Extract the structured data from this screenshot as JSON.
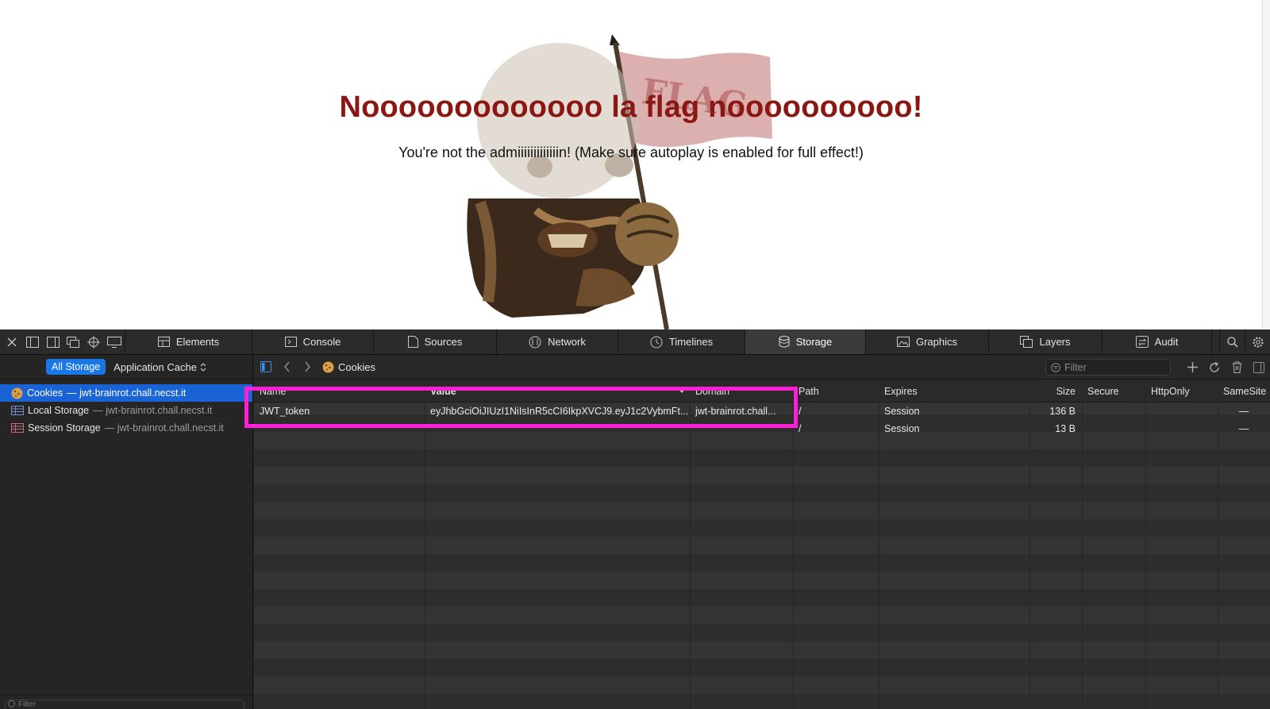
{
  "page": {
    "headline": "Nooooooooooooo la flag noooooooooo!",
    "subline": "You're not the admiiiiiiiiiiiiin! (Make sure autoplay is enabled for full effect!)",
    "flag_text": "FLAG"
  },
  "devtools": {
    "tabs": [
      {
        "label": "Elements",
        "icon": "elements-icon"
      },
      {
        "label": "Console",
        "icon": "console-icon"
      },
      {
        "label": "Sources",
        "icon": "sources-icon"
      },
      {
        "label": "Network",
        "icon": "network-icon"
      },
      {
        "label": "Timelines",
        "icon": "timelines-icon"
      },
      {
        "label": "Storage",
        "icon": "storage-icon",
        "selected": true
      },
      {
        "label": "Graphics",
        "icon": "graphics-icon"
      },
      {
        "label": "Layers",
        "icon": "layers-icon"
      },
      {
        "label": "Audit",
        "icon": "audit-icon"
      }
    ],
    "sidebar": {
      "all_storage": "All Storage",
      "scope_select": "Application Cache",
      "items": [
        {
          "label": "Cookies",
          "host": "— jwt-brainrot.chall.necst.it",
          "icon": "cookie-icon",
          "selected": true
        },
        {
          "label": "Local Storage",
          "host": "— jwt-brainrot.chall.necst.it",
          "icon": "table-icon"
        },
        {
          "label": "Session Storage",
          "host": "— jwt-brainrot.chall.necst.it",
          "icon": "table-icon"
        }
      ],
      "bottom_filter_placeholder": "Filter"
    },
    "content": {
      "breadcrumb": "Cookies",
      "filter_placeholder": "Filter",
      "columns": [
        "Name",
        "Value",
        "Domain",
        "Path",
        "Expires",
        "Size",
        "Secure",
        "HttpOnly",
        "SameSite"
      ],
      "rows": [
        {
          "name": "JWT_token",
          "value": "eyJhbGciOiJIUzI1NiIsInR5cCI6IkpXVCJ9.eyJ1c2VybmFt...",
          "domain": "jwt-brainrot.chall...",
          "path": "/",
          "expires": "Session",
          "size": "136 B",
          "secure": "",
          "httponly": "",
          "samesite": "—"
        },
        {
          "name": "",
          "value": "",
          "domain": "",
          "path": "/",
          "expires": "Session",
          "size": "13 B",
          "secure": "",
          "httponly": "",
          "samesite": "—"
        }
      ]
    },
    "highlight_color": "#ff1fd6"
  }
}
